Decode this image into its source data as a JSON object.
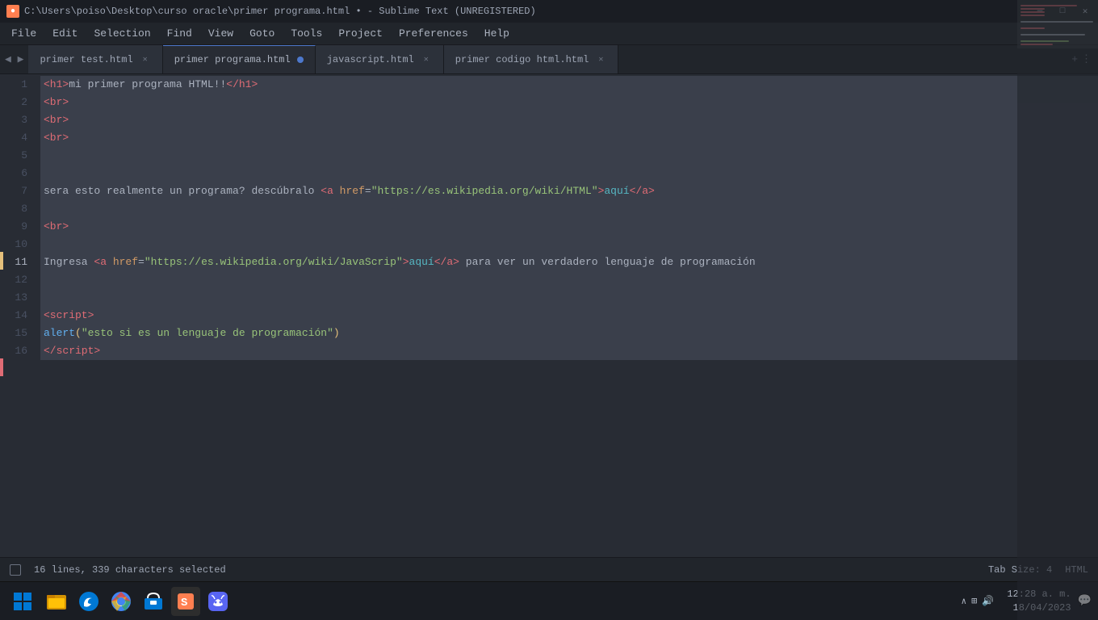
{
  "titleBar": {
    "icon": "●",
    "title": "C:\\Users\\poiso\\Desktop\\curso oracle\\primer programa.html • - Sublime Text (UNREGISTERED)",
    "minimize": "—",
    "maximize": "□",
    "close": "✕"
  },
  "menuBar": {
    "items": [
      "File",
      "Edit",
      "Selection",
      "Find",
      "View",
      "Goto",
      "Tools",
      "Project",
      "Preferences",
      "Help"
    ]
  },
  "tabs": [
    {
      "label": "primer test.html",
      "active": false,
      "modified": false
    },
    {
      "label": "primer programa.html",
      "active": true,
      "modified": true
    },
    {
      "label": "javascript.html",
      "active": false,
      "modified": false
    },
    {
      "label": "primer codigo html.html",
      "active": false,
      "modified": false
    }
  ],
  "statusBar": {
    "selection": "16 lines, 339 characters selected",
    "tabSize": "Tab Size: 4",
    "language": "HTML",
    "date": "18/04/2023",
    "time": "12:28 a. m."
  },
  "taskbar": {
    "time": "12:28 a. m.",
    "date": "18/04/2023"
  }
}
